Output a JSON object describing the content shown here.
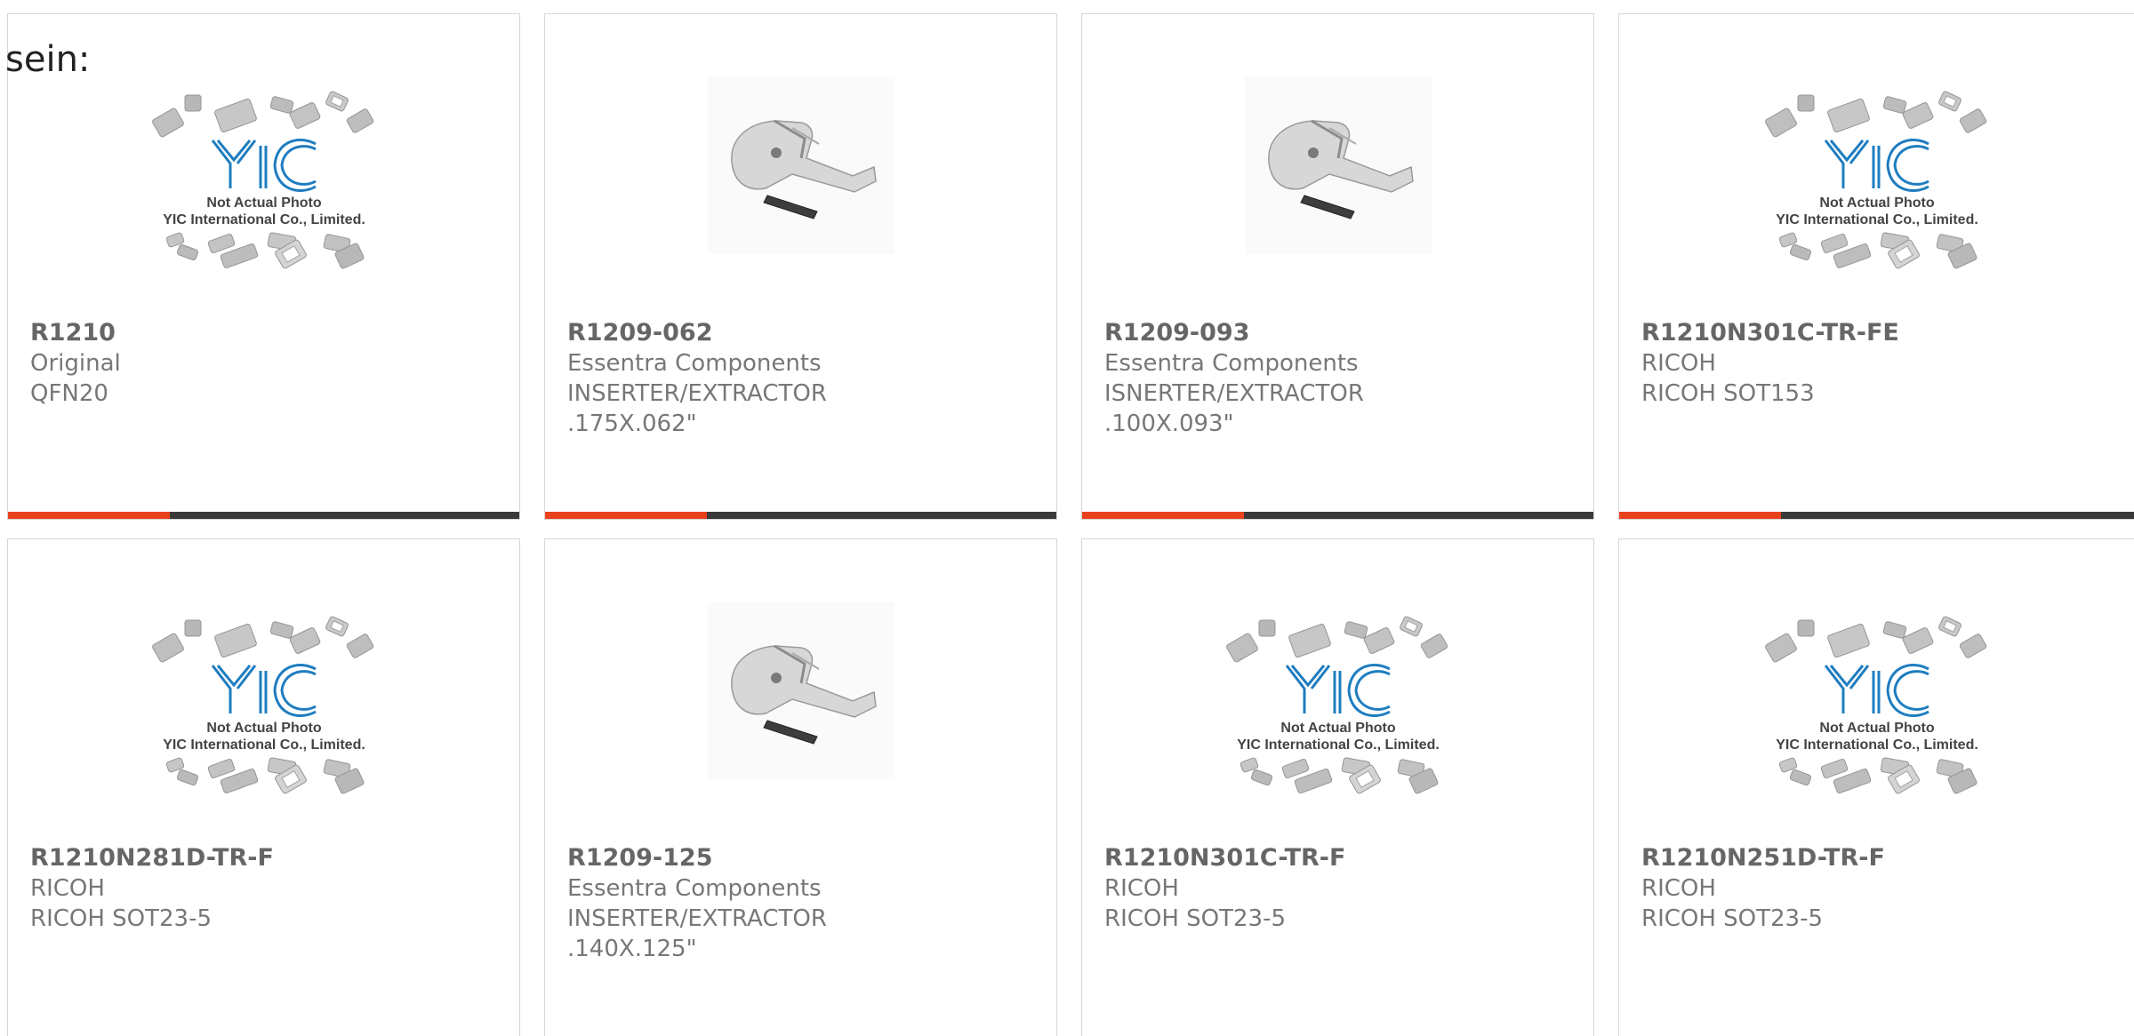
{
  "intro_text": "sein:",
  "placeholder_photo": {
    "line1": "Not Actual Photo",
    "line2": "YIC International Co., Limited.",
    "logo": "YIC"
  },
  "colors": {
    "accent": "#e8411c",
    "bar": "#3a3a3a",
    "logo_blue": "#1e7dc0",
    "text": "#666666"
  },
  "products": [
    {
      "part_number": "R1210",
      "manufacturer": "Original",
      "description": "QFN20",
      "image": "placeholder"
    },
    {
      "part_number": "R1209-062",
      "manufacturer": "Essentra Components",
      "description": "INSERTER/EXTRACTOR .175X.062\"",
      "image": "extractor-tool"
    },
    {
      "part_number": "R1209-093",
      "manufacturer": "Essentra Components",
      "description": "ISNERTER/EXTRACTOR .100X.093\"",
      "image": "extractor-tool"
    },
    {
      "part_number": "R1210N301C-TR-FE",
      "manufacturer": "RICOH",
      "description": "RICOH SOT153",
      "image": "placeholder"
    },
    {
      "part_number": "R1210N281D-TR-F",
      "manufacturer": "RICOH",
      "description": "RICOH SOT23-5",
      "image": "placeholder"
    },
    {
      "part_number": "R1209-125",
      "manufacturer": "Essentra Components",
      "description": "INSERTER/EXTRACTOR .140X.125\"",
      "image": "extractor-tool"
    },
    {
      "part_number": "R1210N301C-TR-F",
      "manufacturer": "RICOH",
      "description": "RICOH SOT23-5",
      "image": "placeholder"
    },
    {
      "part_number": "R1210N251D-TR-F",
      "manufacturer": "RICOH",
      "description": "RICOH SOT23-5",
      "image": "placeholder"
    }
  ]
}
